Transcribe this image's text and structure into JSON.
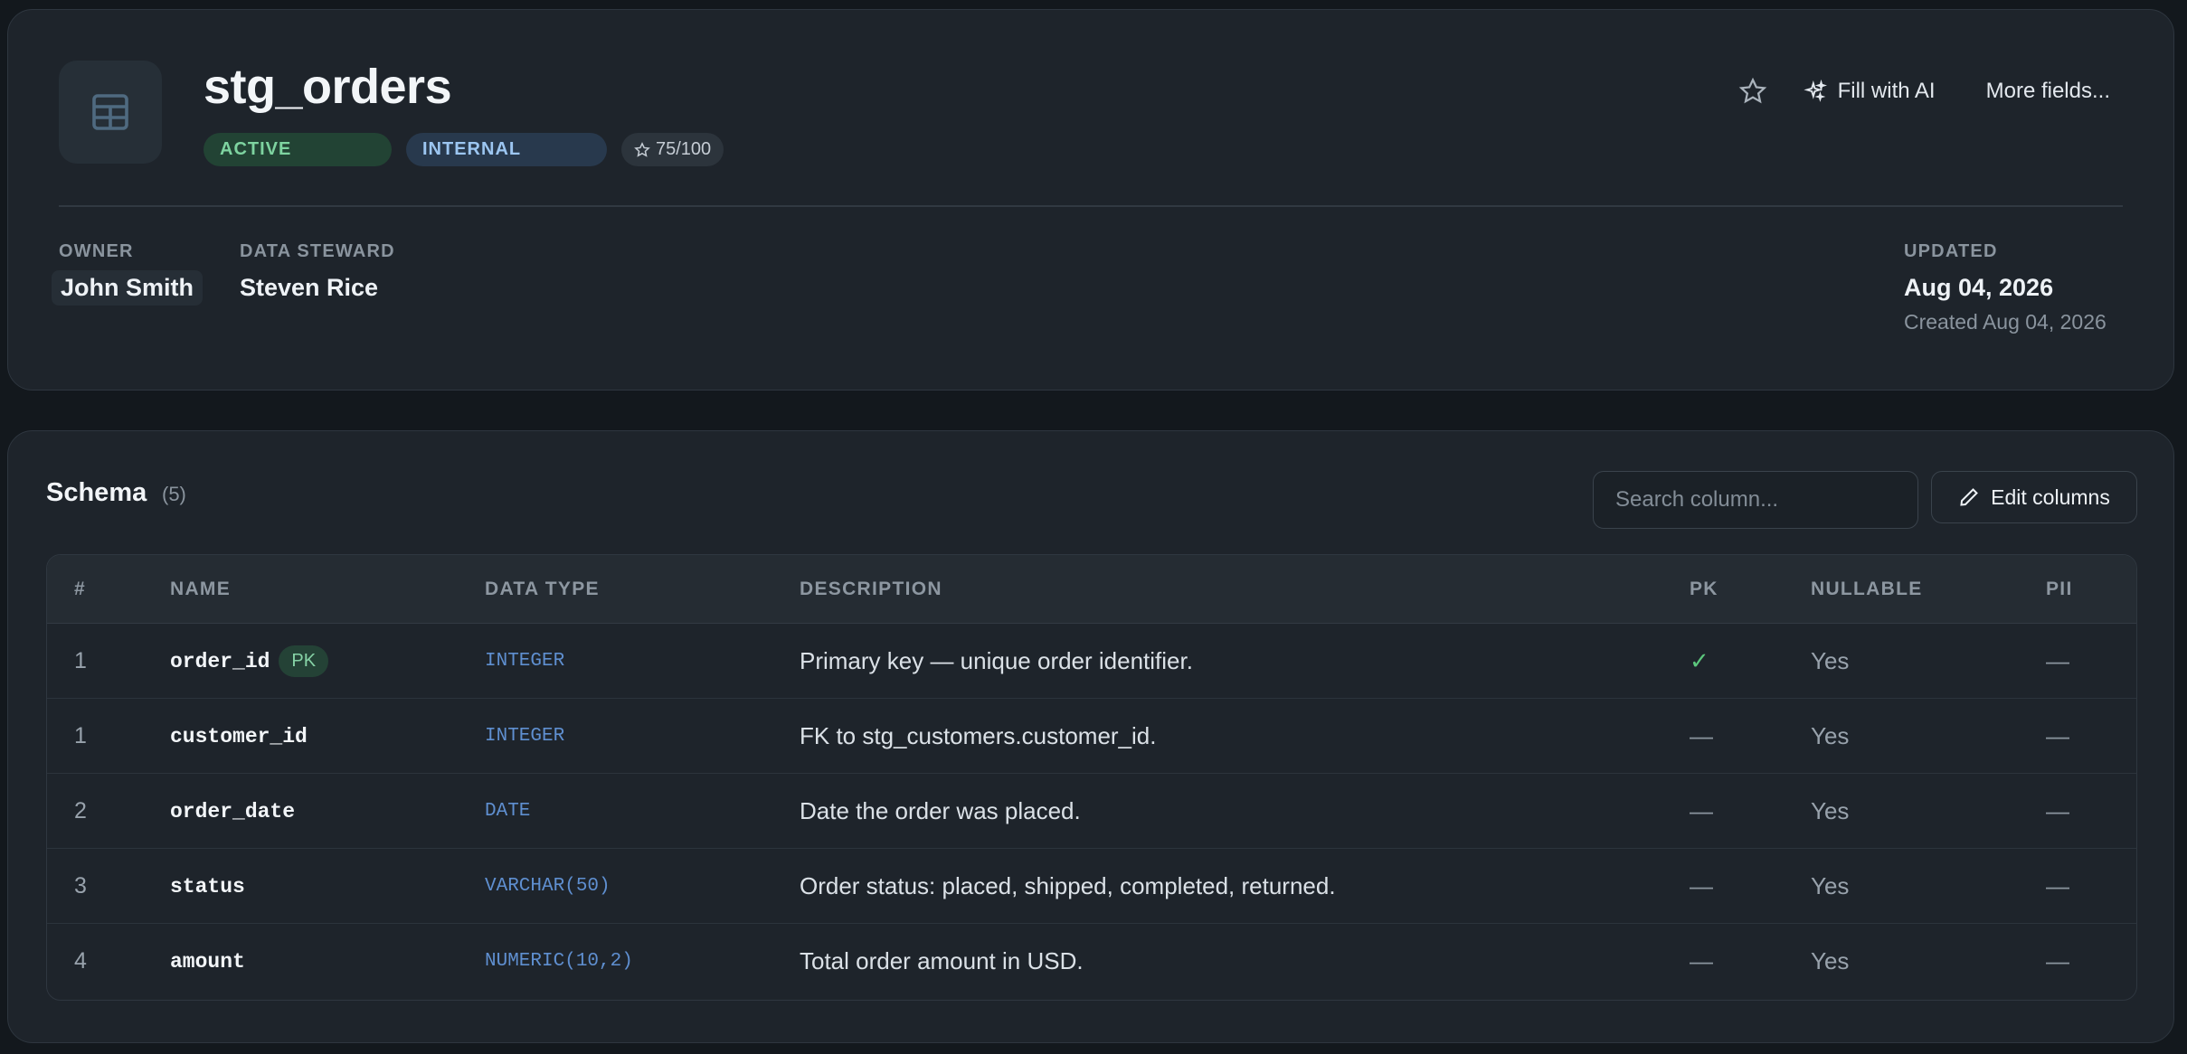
{
  "asset": {
    "name": "stg_orders",
    "icon": "table-icon",
    "status_badge": "ACTIVE",
    "classification_badge": "INTERNAL",
    "score": "75/100",
    "actions": {
      "favorite_icon": "star-icon",
      "fill_ai_label": "Fill with AI",
      "more_fields_label": "More fields..."
    },
    "owner": {
      "label": "OWNER",
      "value": "John Smith"
    },
    "steward": {
      "label": "DATA STEWARD",
      "value": "Steven Rice"
    },
    "updated": {
      "label": "UPDATED",
      "value": "Aug 04, 2026",
      "created": "Created Aug 04, 2026"
    }
  },
  "schema": {
    "title": "Schema",
    "count": "(5)",
    "search_placeholder": "Search column...",
    "edit_label": "Edit columns",
    "headers": {
      "num": "#",
      "name": "NAME",
      "type": "DATA TYPE",
      "description": "DESCRIPTION",
      "pk": "PK",
      "nullable": "NULLABLE",
      "pii": "PII"
    },
    "rows": [
      {
        "num": "1",
        "name": "order_id",
        "pk_pill": "PK",
        "type": "INTEGER",
        "description": "Primary key — unique order identifier.",
        "pk": "✓",
        "nullable": "Yes",
        "pii": "—"
      },
      {
        "num": "1",
        "name": "customer_id",
        "pk_pill": "",
        "type": "INTEGER",
        "description": "FK to stg_customers.customer_id.",
        "pk": "—",
        "nullable": "Yes",
        "pii": "—"
      },
      {
        "num": "2",
        "name": "order_date",
        "pk_pill": "",
        "type": "DATE",
        "description": "Date the order was placed.",
        "pk": "—",
        "nullable": "Yes",
        "pii": "—"
      },
      {
        "num": "3",
        "name": "status",
        "pk_pill": "",
        "type": "VARCHAR(50)",
        "description": "Order status: placed, shipped, completed, returned.",
        "pk": "—",
        "nullable": "Yes",
        "pii": "—"
      },
      {
        "num": "4",
        "name": "amount",
        "pk_pill": "",
        "type": "NUMERIC(10,2)",
        "description": "Total order amount in USD.",
        "pk": "—",
        "nullable": "Yes",
        "pii": "—"
      }
    ]
  },
  "colors": {
    "background": "#13181d",
    "card": "#1e242b",
    "active_badge": "#224334",
    "internal_badge": "#28394d",
    "type_text": "#5f8fd0",
    "pk_check": "#5cc77d"
  }
}
